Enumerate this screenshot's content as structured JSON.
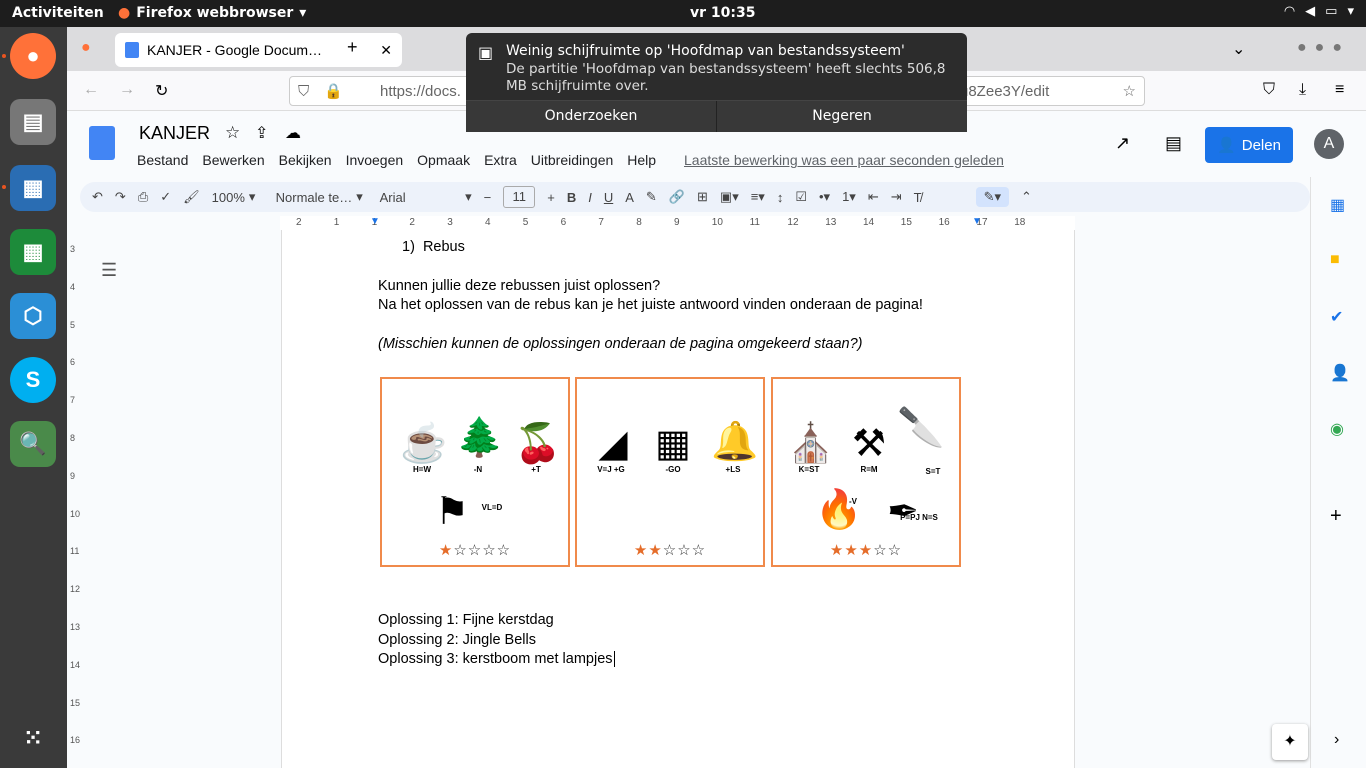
{
  "topbar": {
    "activities": "Activiteiten",
    "app": "Firefox webbrowser",
    "clock": "vr 10:35"
  },
  "browser": {
    "tab_title": "KANJER - Google Docum…",
    "url_left": "https://docs.",
    "url_right": "u8Zee3Y/edit"
  },
  "notification": {
    "title": "Weinig schijfruimte op 'Hoofdmap van bestandssysteem'",
    "body": "De partitie 'Hoofdmap van bestandssysteem' heeft slechts 506,8 MB schijfruimte over.",
    "action1": "Onderzoeken",
    "action2": "Negeren"
  },
  "doc": {
    "title": "KANJER",
    "menu": [
      "Bestand",
      "Bewerken",
      "Bekijken",
      "Invoegen",
      "Opmaak",
      "Extra",
      "Uitbreidingen",
      "Help"
    ],
    "last_edit": "Laatste bewerking was een paar seconden geleden",
    "share": "Delen",
    "avatar": "A"
  },
  "toolbar": {
    "zoom": "100%",
    "style": "Normale te…",
    "font": "Arial",
    "size": "11"
  },
  "ruler": [
    "2",
    "1",
    "1",
    "2",
    "3",
    "4",
    "5",
    "6",
    "7",
    "8",
    "9",
    "10",
    "11",
    "12",
    "13",
    "14",
    "15",
    "16",
    "17",
    "18"
  ],
  "vruler": [
    "3",
    "4",
    "5",
    "6",
    "7",
    "8",
    "9",
    "10",
    "11",
    "12",
    "13",
    "14",
    "15",
    "16"
  ],
  "content": {
    "list_item": "1)  Rebus",
    "p1": "Kunnen jullie deze rebussen juist oplossen?",
    "p2": "Na het oplossen van de rebus kan je het juiste antwoord vinden onderaan de pagina!",
    "p3": "(Misschien kunnen de oplossingen onderaan de pagina omgekeerd staan?)",
    "sol1": "Oplossing 1: Fijne kerstdag",
    "sol2": "Oplossing 2: Jingle Bells",
    "sol3": "Oplossing 3: kerstboom met lampjes"
  },
  "rebus": [
    {
      "labels": [
        "H=W",
        "-N",
        "+T",
        "VL=D"
      ],
      "rating": 1,
      "icons": [
        "cup-icon",
        "tree-icon",
        "cherry-icon",
        "flag-icon"
      ]
    },
    {
      "labels": [
        "V=J +G",
        "-GO",
        "+LS"
      ],
      "rating": 2,
      "icons": [
        "shark-fin-icon",
        "bricks-icon",
        "bell-icon"
      ]
    },
    {
      "labels": [
        "K=ST",
        "R=M",
        "S=T",
        "-V",
        "P=PJ N=S"
      ],
      "rating": 3,
      "icons": [
        "church-icon",
        "drill-icon",
        "knife-icon",
        "match-icon",
        "pen-icon"
      ]
    }
  ],
  "colors": {
    "accent": "#1a73e8",
    "card_border": "#f08a4b",
    "star": "#e56d2a"
  }
}
